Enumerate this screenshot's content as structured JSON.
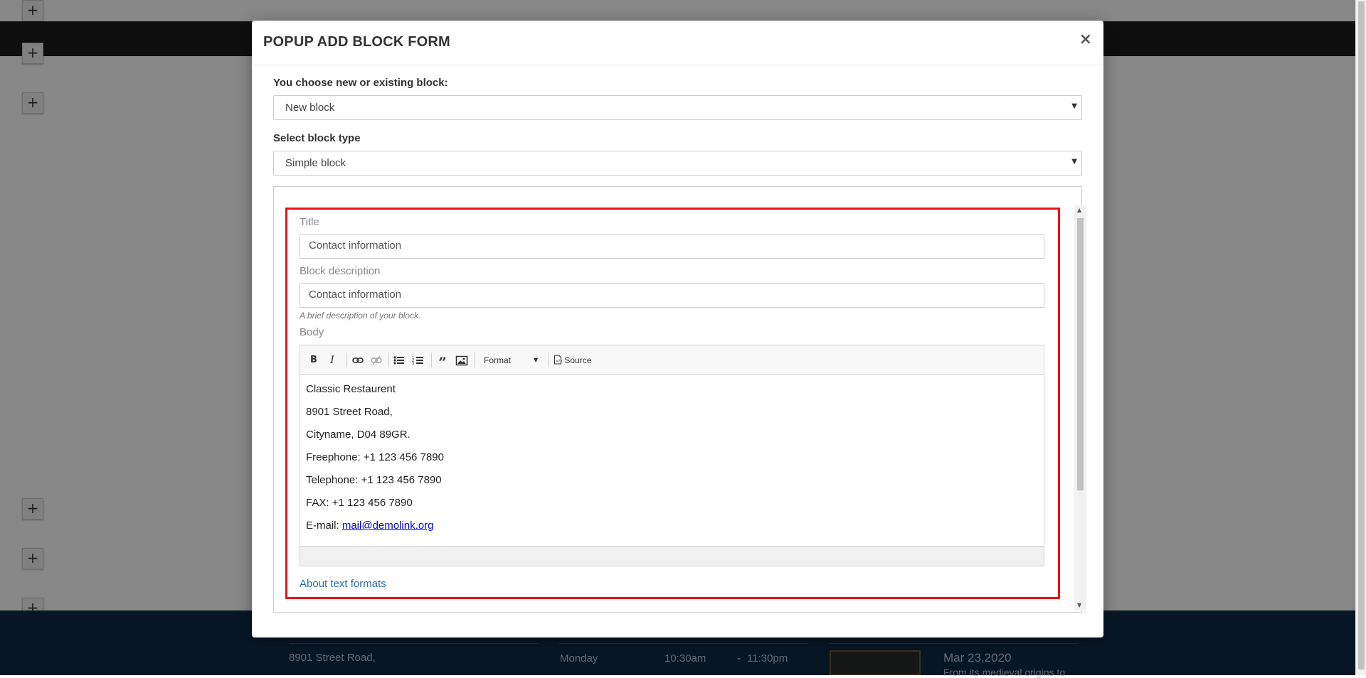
{
  "background": {
    "footer_texts": {
      "address": "8901 Street Road,",
      "hours_day": "Monday",
      "hours_open": "10:30am",
      "hours_dash": "-",
      "hours_close": "11:30pm",
      "post_date": "Mar 23,2020",
      "post_excerpt": "From its medieval origins to"
    },
    "add_button_symbol": "+"
  },
  "modal": {
    "title": "POPUP ADD BLOCK FORM",
    "close_symbol": "×",
    "block_choice": {
      "label": "You choose new or existing block:",
      "selected": "New block"
    },
    "block_type": {
      "label": "Select block type",
      "selected": "Simple block"
    },
    "form": {
      "title_label": "Title",
      "title_value": "Contact information",
      "description_label": "Block description",
      "description_value": "Contact information",
      "description_help": "A brief description of your block.",
      "body_label": "Body",
      "toolbar": {
        "bold": "B",
        "italic": "I",
        "format": "Format",
        "source": "Source"
      },
      "body_lines": [
        "Classic Restaurent",
        "8901 Street Road,",
        "Cityname, D04 89GR.",
        "Freephone: +1 123 456 7890",
        "Telephone: +1 123 456 7890",
        "FAX: +1 123 456 7890"
      ],
      "email_prefix": "E-mail: ",
      "email_link": "mail@demolink.org",
      "about_link": "About text formats"
    }
  },
  "colors": {
    "highlight_border": "#ee1111",
    "link": "#0000ee",
    "footer_bg": "#0e2a47"
  }
}
